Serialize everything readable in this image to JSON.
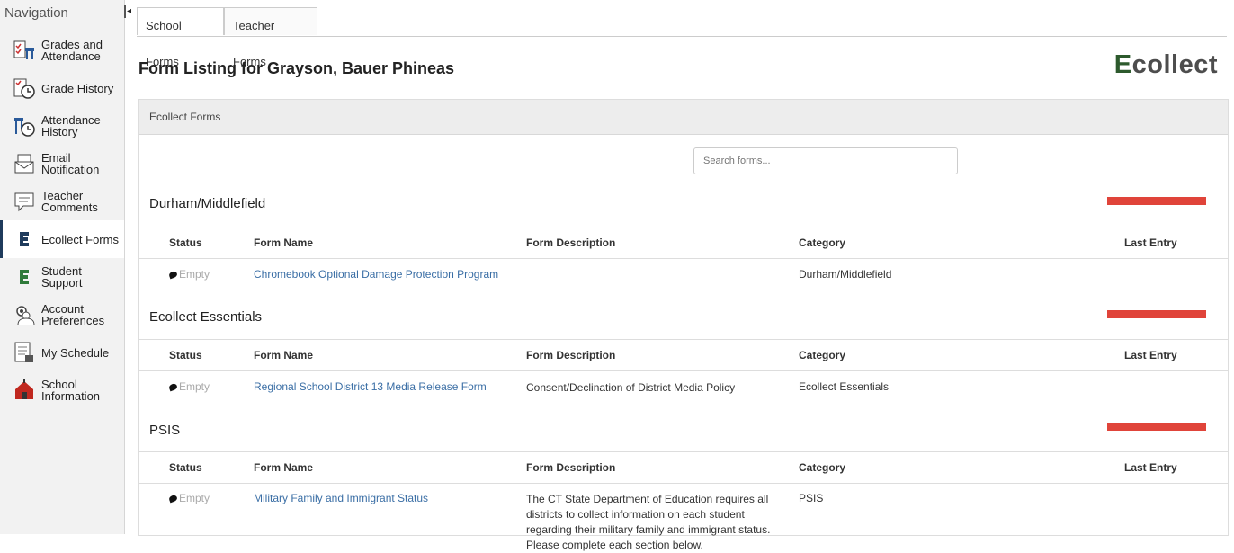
{
  "sidebar": {
    "header": "Navigation",
    "collapse_glyph": "◂",
    "items": [
      {
        "label": "Grades and Attendance",
        "icon": "grades-attendance-icon"
      },
      {
        "label": "Grade History",
        "icon": "grade-history-icon"
      },
      {
        "label": "Attendance History",
        "icon": "attendance-history-icon"
      },
      {
        "label": "Email Notification",
        "icon": "email-icon"
      },
      {
        "label": "Teacher Comments",
        "icon": "comments-icon"
      },
      {
        "label": "Ecollect Forms",
        "icon": "ecollect-icon",
        "active": true
      },
      {
        "label": "Student Support",
        "icon": "student-support-icon"
      },
      {
        "label": "Account Preferences",
        "icon": "account-preferences-icon"
      },
      {
        "label": "My Schedule",
        "icon": "schedule-icon"
      },
      {
        "label": "School Information",
        "icon": "school-icon"
      }
    ]
  },
  "tabs": [
    "School Forms",
    "Teacher Forms"
  ],
  "page_title": "Form Listing for Grayson, Bauer Phineas",
  "logo": {
    "prefix": "E",
    "rest": "collect"
  },
  "panel_header": "Ecollect Forms",
  "search": {
    "placeholder": "Search forms..."
  },
  "columns": [
    "Status",
    "Form Name",
    "Form Description",
    "Category",
    "Last Entry"
  ],
  "sections": [
    {
      "title": "Durham/Middlefield",
      "row": {
        "status": "Empty",
        "name": "Chromebook Optional Damage Protection Program",
        "description": "",
        "category": "Durham/Middlefield",
        "last_entry": ""
      }
    },
    {
      "title": "Ecollect Essentials",
      "row": {
        "status": "Empty",
        "name": "Regional School District 13 Media Release Form",
        "description": "Consent/Declination of District Media Policy",
        "category": "Ecollect Essentials",
        "last_entry": ""
      }
    },
    {
      "title": "PSIS",
      "row": {
        "status": "Empty",
        "name": "Military Family and Immigrant Status",
        "description": "The CT State Department of Education requires all districts to collect information on each student regarding their military family and immigrant status. Please complete each section below.",
        "category": "PSIS",
        "last_entry": ""
      }
    }
  ],
  "colors": {
    "accent_red": "#e0443a",
    "link": "#3a6ea5",
    "active_border": "#1f3b5c"
  }
}
